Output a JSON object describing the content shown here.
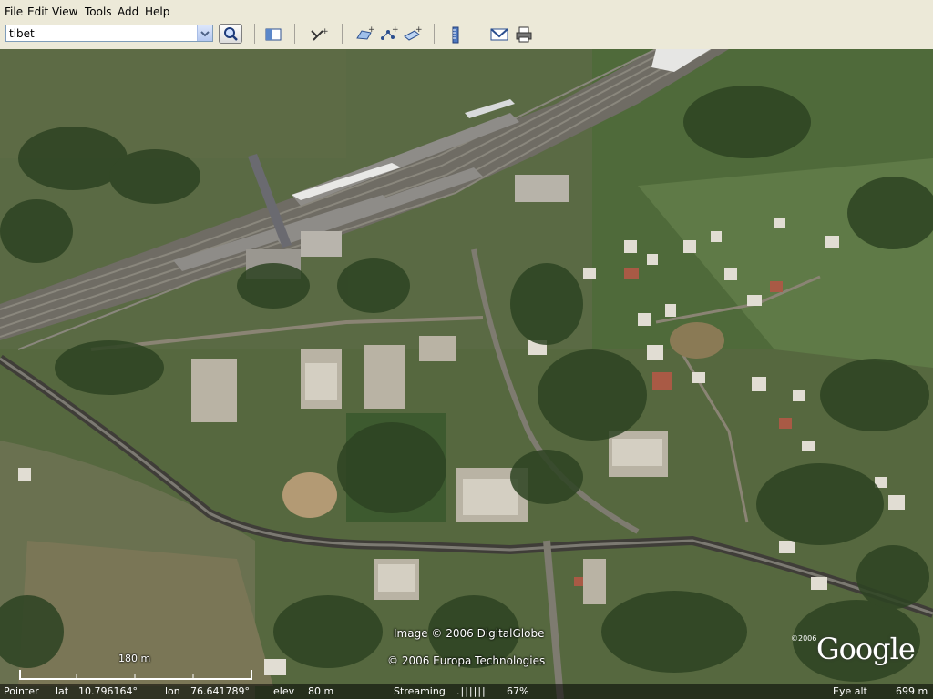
{
  "menu": {
    "items": [
      {
        "label": "File",
        "key": "F"
      },
      {
        "label": "Edit",
        "key": "E"
      },
      {
        "label": "View",
        "key": "V"
      },
      {
        "label": "Tools",
        "key": "T"
      },
      {
        "label": "Add",
        "key": "A"
      },
      {
        "label": "Help",
        "key": "H"
      }
    ]
  },
  "search": {
    "value": "tibet"
  },
  "map": {
    "credit_image": "Image © 2006 DigitalGlobe",
    "credit_data": "© 2006 Europa Technologies",
    "logo_year": "©2006",
    "logo": "Google",
    "scale_label": "180 m"
  },
  "status": {
    "pointer_label": "Pointer",
    "lat_label": "lat",
    "lat_value": "10.796164°",
    "lon_label": "lon",
    "lon_value": "76.641789°",
    "elev_label": "elev",
    "elev_value": "80 m",
    "streaming_label": "Streaming",
    "streaming_bars": ".||||||",
    "streaming_percent": "67%",
    "progress": 0.67,
    "eye_alt_label": "Eye alt",
    "eye_alt_value": "699 m"
  },
  "icons": {
    "search": "magnifier-icon",
    "sidebar": "sidebar-toggle-icon",
    "placemark": "add-placemark-icon",
    "polygon": "add-polygon-icon",
    "path": "add-path-icon",
    "overlay": "image-overlay-icon",
    "ruler": "ruler-icon",
    "email": "email-icon",
    "print": "print-icon",
    "view": "navigation-toggle-icon"
  }
}
